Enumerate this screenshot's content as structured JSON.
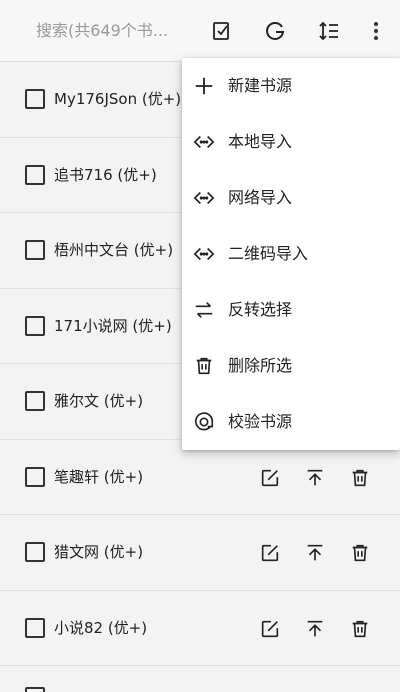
{
  "toolbar": {
    "search_placeholder": "搜索(共649个书...",
    "icons": [
      "select-edit-icon",
      "g-icon",
      "sort-icon",
      "more-vert-icon"
    ]
  },
  "sources": [
    {
      "label": "My176JSon (优+)"
    },
    {
      "label": "追书716 (优+)"
    },
    {
      "label": "梧州中文台 (优+)"
    },
    {
      "label": "171小说网 (优+)"
    },
    {
      "label": "雅尔文 (优+)"
    },
    {
      "label": "笔趣轩 (优+)"
    },
    {
      "label": "猎文网 (优+)"
    },
    {
      "label": "小说82 (优+)"
    }
  ],
  "menu": {
    "items": [
      {
        "label": "新建书源",
        "icon": "add-icon"
      },
      {
        "label": "本地导入",
        "icon": "code-icon"
      },
      {
        "label": "网络导入",
        "icon": "code-icon"
      },
      {
        "label": "二维码导入",
        "icon": "code-icon"
      },
      {
        "label": "反转选择",
        "icon": "swap-icon"
      },
      {
        "label": "删除所选",
        "icon": "trash-icon"
      },
      {
        "label": "校验书源",
        "icon": "check-circle-icon"
      }
    ]
  }
}
